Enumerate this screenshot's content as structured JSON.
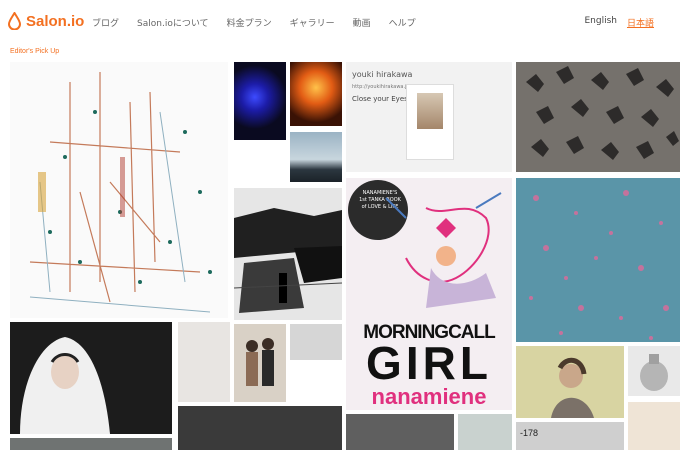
{
  "header": {
    "logo_text": "Salon.io",
    "nav": [
      "ブログ",
      "Salon.ioについて",
      "料金プラン",
      "ギャラリー",
      "動画",
      "ヘルプ"
    ],
    "lang_en": "English",
    "lang_ja": "日本語",
    "accent_color": "#f37021"
  },
  "section_label": "Editor's Pick Up",
  "tiles": {
    "profile_card": {
      "user_name": "youki hirakawa",
      "user_url": "http://youkihirakawa.jp/",
      "work_title": "Close your Eyes"
    },
    "book_cover": {
      "circle_text": "NANAMIENE'S 1st TANKA BOOK of LOVE & LIFE",
      "line1": "MORNINGCALL",
      "line2": "GIRL",
      "line3": "nanamiene"
    },
    "bottom_number": "-178"
  }
}
